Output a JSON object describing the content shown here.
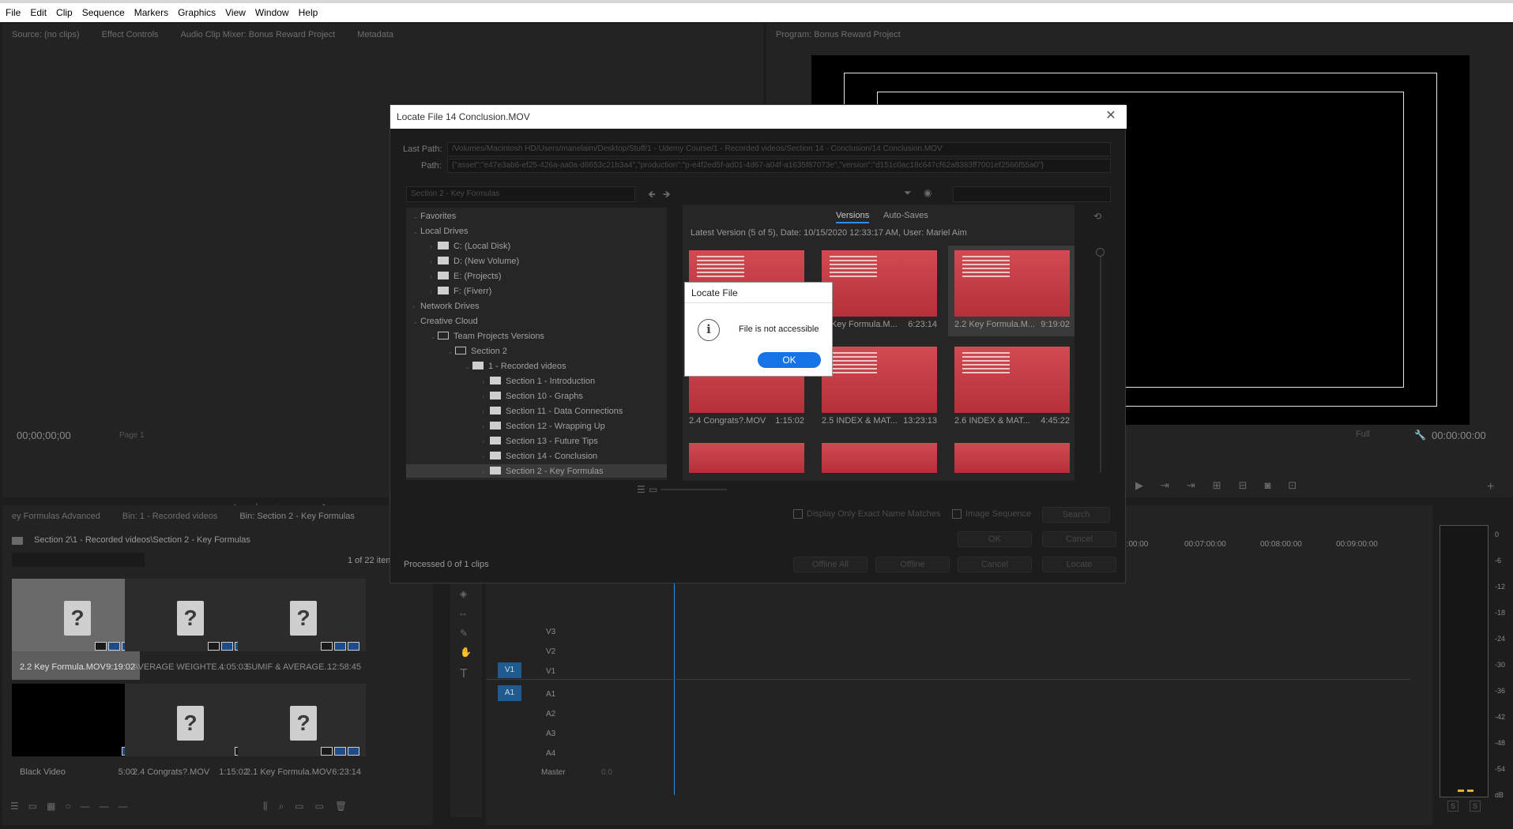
{
  "menu": [
    "File",
    "Edit",
    "Clip",
    "Sequence",
    "Markers",
    "Graphics",
    "View",
    "Window",
    "Help"
  ],
  "source_panel": {
    "tabs": [
      "Source: (no clips)",
      "Effect Controls",
      "Audio Clip Mixer: Bonus Reward Project",
      "Metadata"
    ],
    "timecode": "00;00;00;00",
    "page": "Page 1"
  },
  "program_panel": {
    "tab": "Program: Bonus Reward Project",
    "fit": "Full",
    "timecode": "00:00:00:00"
  },
  "project_panel": {
    "tabs": [
      "ey Formulas Advanced",
      "Bin: 1 - Recorded videos",
      "Bin: Section 2 - Key Formulas"
    ],
    "path": "Section 2\\1 - Recorded videos\\Section 2 - Key Formulas",
    "count": "1 of 22 item",
    "items": [
      {
        "name": "2.2 Key Formula.MOV",
        "duration": "9:19:02"
      },
      {
        "name": "AVERAGE WEIGHTE...",
        "duration": "4:05:03"
      },
      {
        "name": "SUMIF & AVERAGE...",
        "duration": "12:58:45"
      },
      {
        "name": "Black Video",
        "duration": "5:00"
      },
      {
        "name": "2.4 Congrats?.MOV",
        "duration": "1:15:02"
      },
      {
        "name": "2.1 Key Formula.MOV",
        "duration": "6:23:14"
      }
    ]
  },
  "timeline": {
    "ruler": [
      "5:00:00",
      "00:07:00:00",
      "00:08:00:00",
      "00:09:00:00"
    ],
    "video_tracks": [
      "V3",
      "V2",
      "V1"
    ],
    "audio_tracks": [
      "A1",
      "A2",
      "A3",
      "A4"
    ],
    "master": "Master",
    "master_value": "0.0",
    "src_v1": "V1",
    "src_a1": "A1"
  },
  "meter_db": [
    "0",
    "-6",
    "-12",
    "-18",
    "-24",
    "-30",
    "-36",
    "-42",
    "-48",
    "-54",
    "dB"
  ],
  "meter_solo": [
    "S",
    "S"
  ],
  "dialog": {
    "title": "Locate File 14 Conclusion.MOV",
    "last_path_label": "Last Path:",
    "last_path": "/Volumes/Macintosh HD/Users/manelaim/Desktop/Stuff/1 - Udemy Course/1 - Recorded videos/Section 14 - Conclusion/14 Conclusion.MOV",
    "path_label": "Path:",
    "path": "{\"asset\":\"e47e3ab6-ef25-426a-aa0a-d6653c21b3a4\",\"production\":\"p-e4f2ed5f-ad01-4d67-a04f-a1635f87073e\",\"version\":\"d151c0ac18c647cf62a8383ff7001ef2566f55a0\"}",
    "location_select": "Section 2 - Key Formulas",
    "tree": [
      {
        "label": "Favorites",
        "level": 0
      },
      {
        "label": "Local Drives",
        "level": 0
      },
      {
        "label": "C: (Local Disk)",
        "level": 2,
        "icon": "drive"
      },
      {
        "label": "D: (New Volume)",
        "level": 2,
        "icon": "drive"
      },
      {
        "label": "E: (Projects)",
        "level": 2,
        "icon": "drive"
      },
      {
        "label": "F: (Fiverr)",
        "level": 2,
        "icon": "drive"
      },
      {
        "label": "Network Drives",
        "level": 0
      },
      {
        "label": "Creative Cloud",
        "level": 0
      },
      {
        "label": "Team Projects Versions",
        "level": 2,
        "icon": "team"
      },
      {
        "label": "Section 2",
        "level": 3,
        "icon": "project"
      },
      {
        "label": "1 - Recorded videos",
        "level": 4,
        "icon": "folder"
      },
      {
        "label": "Section 1 - Introduction",
        "level": 5,
        "icon": "folder"
      },
      {
        "label": "Section 10 - Graphs",
        "level": 5,
        "icon": "folder"
      },
      {
        "label": "Section 11 - Data Connections",
        "level": 5,
        "icon": "folder"
      },
      {
        "label": "Section 12 - Wrapping Up",
        "level": 5,
        "icon": "folder"
      },
      {
        "label": "Section 13 - Future Tips",
        "level": 5,
        "icon": "folder"
      },
      {
        "label": "Section 14 - Conclusion",
        "level": 5,
        "icon": "folder"
      },
      {
        "label": "Section 2 - Key Formulas",
        "level": 5,
        "icon": "folder"
      }
    ],
    "version_tabs": [
      "Versions",
      "Auto-Saves"
    ],
    "latest": "Latest Version (5 of 5), Date: 10/15/2020 12:33:17 AM, User: Mariel Aim",
    "versions": [
      {
        "name": "",
        "duration": ""
      },
      {
        "name": "Key Formula.M...",
        "duration": "6:23:14"
      },
      {
        "name": "2.2 Key Formula.M...",
        "duration": "9:19:02"
      },
      {
        "name": "2.4 Congrats?.MOV",
        "duration": "1:15:02"
      },
      {
        "name": "2.5 INDEX & MAT...",
        "duration": "13:23:13"
      },
      {
        "name": "2.6 INDEX & MAT...",
        "duration": "4:45:22"
      }
    ],
    "thumb_text": [
      "Media offline",
      "メディアオフライン",
      "Média hors ligne",
      "Media offline",
      "Medien offline",
      "Medios sin conexión",
      "Oggetti multimediali non in linea",
      "오프라인 미디어",
      "Мультимедиа в автономном режиме",
      "Mídia offline"
    ],
    "exact_match": "Display Only Exact Name Matches",
    "image_sequence": "Image Sequence",
    "search": "Search",
    "ok": "OK",
    "cancel": "Cancel",
    "offline_all": "Offline All",
    "offline": "Offline",
    "cancel2": "Cancel",
    "locate": "Locate",
    "processed": "Processed 0 of 1 clips"
  },
  "alert": {
    "title": "Locate File",
    "message": "File is not accessible",
    "ok": "OK"
  }
}
